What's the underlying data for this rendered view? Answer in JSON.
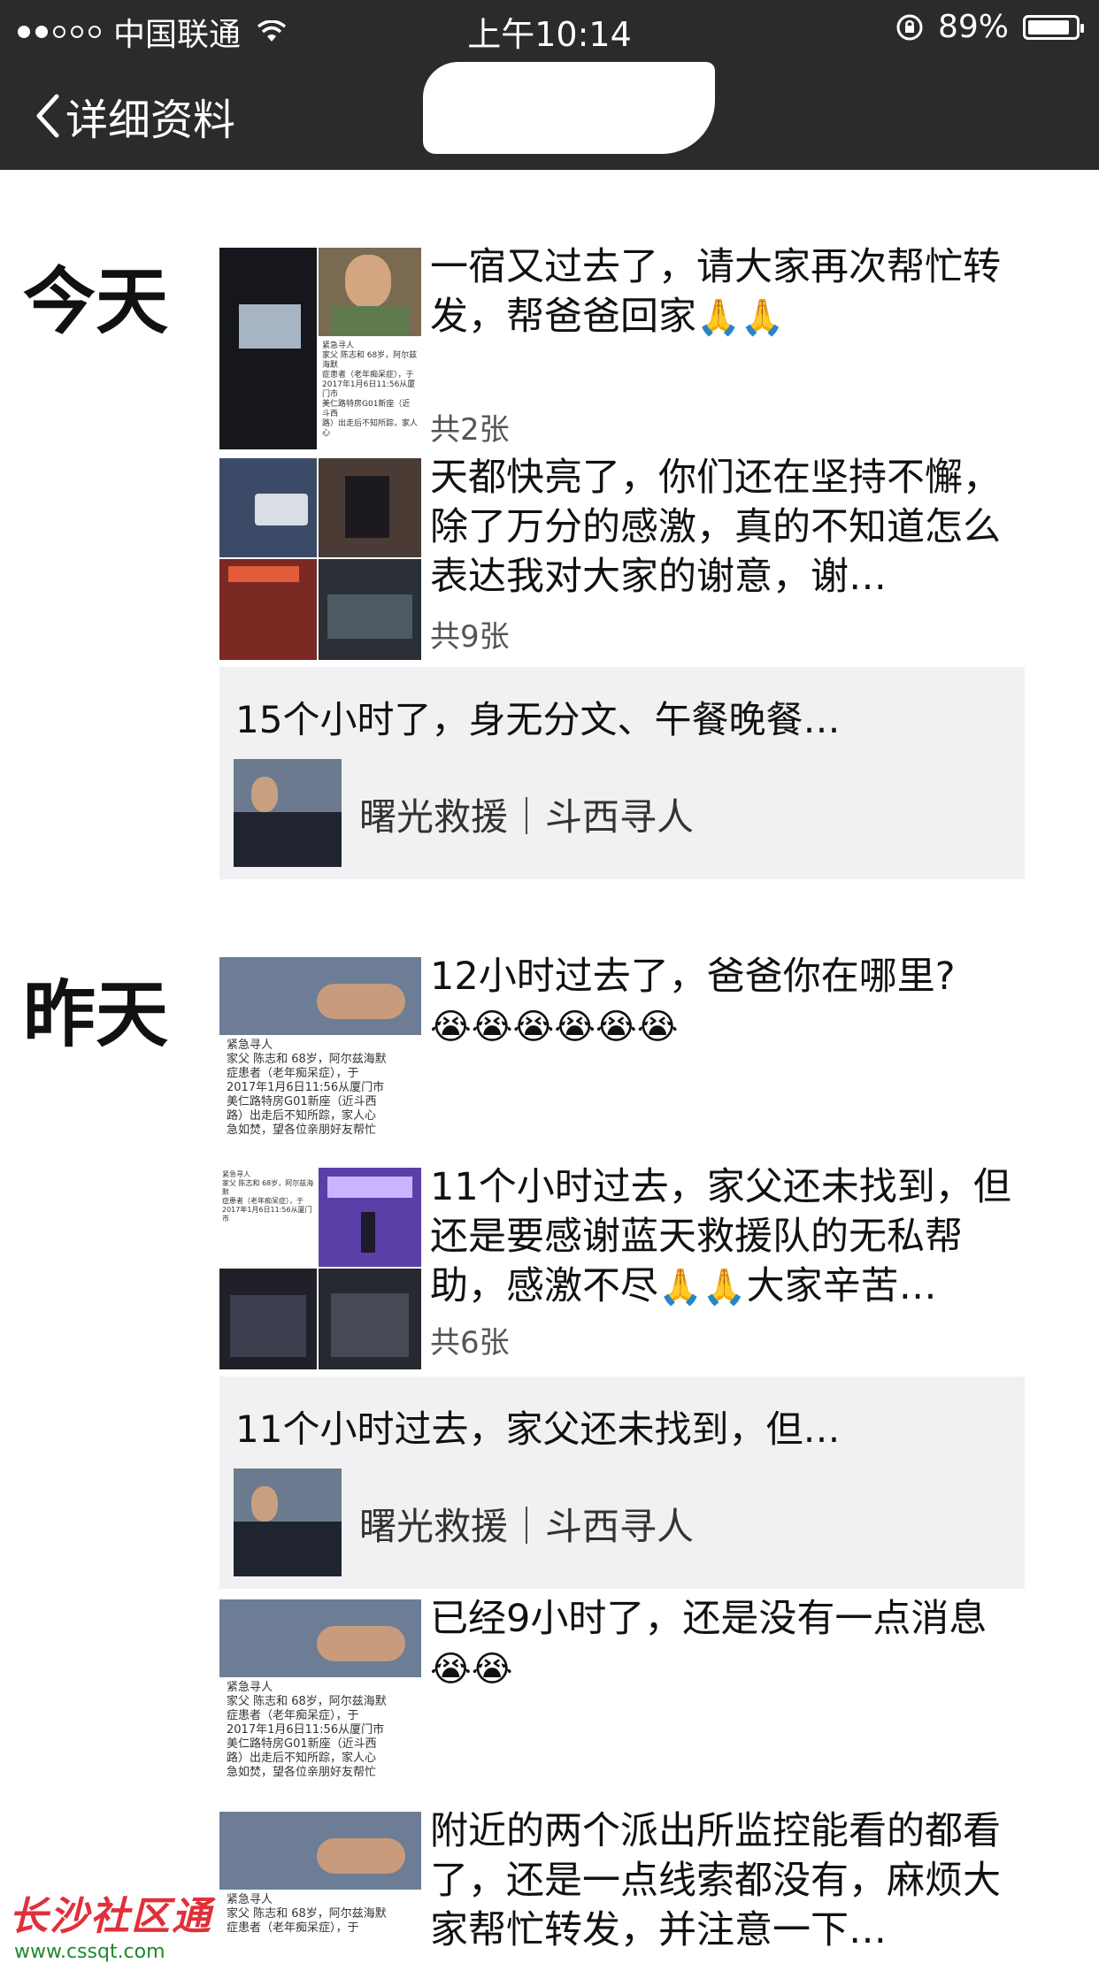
{
  "status": {
    "carrier": "中国联通",
    "time": "上午10:14",
    "battery": "89%",
    "signal_dots_filled": 2,
    "signal_dots_total": 5
  },
  "nav": {
    "back_label": "详细资料"
  },
  "days": [
    {
      "label": "今天"
    },
    {
      "label": "昨天"
    }
  ],
  "posts": [
    {
      "text": "一宿又过去了，请大家再次帮忙转发，帮爸爸回家",
      "emoji": "🙏🙏",
      "count": "共2张"
    },
    {
      "text": "天都快亮了，你们还在坚持不懈，除了万分的感激，真的不知道怎么表达我对大家的谢意，谢…",
      "count": "共9张"
    },
    {
      "text": "12小时过去了，爸爸你在哪里?",
      "emoji": "😭😭😭😭😭😭"
    },
    {
      "text_before": "11个小时过去，家父还未找到，但还是要感谢蓝天救援队的无私帮助，感激不尽",
      "emoji": "🙏🙏",
      "text_after": "大家辛苦…",
      "count": "共6张"
    },
    {
      "text": "已经9小时了，还是没有一点消息",
      "emoji": "😭😭"
    },
    {
      "text": "附近的两个派出所监控能看的都看了，还是一点线索都没有，麻烦大家帮忙转发，并注意一下…"
    }
  ],
  "shares": [
    {
      "title": "15个小时了，身无分文、午餐晚餐…",
      "source": "曙光救援｜斗西寻人"
    },
    {
      "title": "11个小时过去，家父还未找到，但…",
      "source": "曙光救援｜斗西寻人"
    }
  ],
  "notice": {
    "heading": "紧急寻人",
    "lines": [
      "家父 陈志和 68岁，阿尔兹海默",
      "症患者（老年痴呆症），于",
      "2017年1月6日11:56从厦门市",
      "美仁路特房G01新座（近斗西",
      "路）出走后不知所踪，家人心",
      "急如焚，望各位亲朋好友帮忙"
    ]
  },
  "watermark": {
    "title": "长沙社区通",
    "url": "www.cssqt.com"
  }
}
